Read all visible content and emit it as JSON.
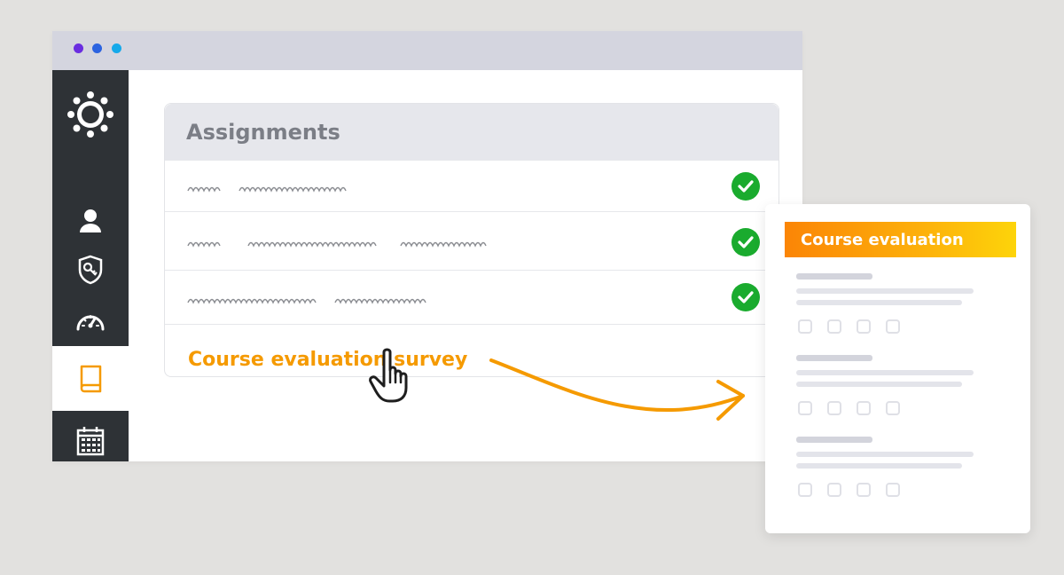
{
  "window": {
    "dots": [
      "#6a2de0",
      "#2b63e0",
      "#15a9ea"
    ]
  },
  "sidebar": {
    "items": [
      {
        "icon": "canvas-logo-icon",
        "active": false
      },
      {
        "icon": "user-icon",
        "active": false
      },
      {
        "icon": "shield-key-icon",
        "active": false
      },
      {
        "icon": "dashboard-gauge-icon",
        "active": false
      },
      {
        "icon": "book-icon",
        "active": true
      },
      {
        "icon": "calendar-icon",
        "active": false
      }
    ]
  },
  "assignments": {
    "title": "Assignments",
    "rows": [
      {
        "status": "complete",
        "icon": "check-circle-icon"
      },
      {
        "status": "complete",
        "icon": "check-circle-icon"
      },
      {
        "status": "complete",
        "icon": "check-circle-icon"
      }
    ],
    "survey_link": "Course evaluation survey"
  },
  "evaluation": {
    "title": "Course evaluation",
    "question_count": 3,
    "options_per_question": 4
  },
  "colors": {
    "accent": "#f59a00",
    "check": "#1aab2e",
    "sidebar": "#2e3236"
  }
}
